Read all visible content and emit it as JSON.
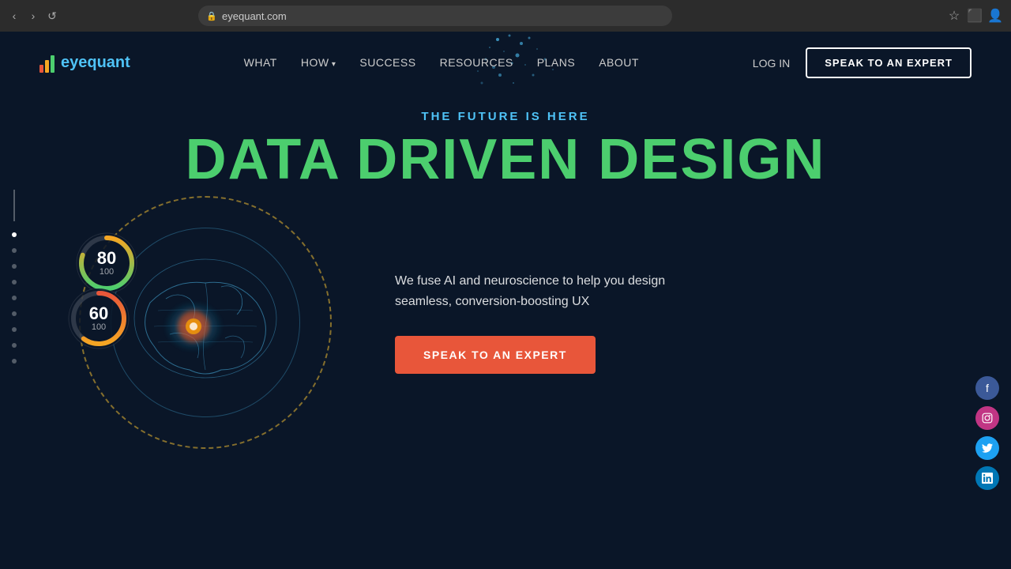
{
  "browser": {
    "url": "eyequant.com",
    "nav_back": "‹",
    "nav_forward": "›",
    "reload": "↺"
  },
  "navbar": {
    "logo_text_1": "eye",
    "logo_text_2": "quant",
    "nav_items": [
      {
        "label": "WHAT",
        "has_arrow": false
      },
      {
        "label": "HOW",
        "has_arrow": true
      },
      {
        "label": "SUCCESS",
        "has_arrow": false
      },
      {
        "label": "RESOURCES",
        "has_arrow": false
      },
      {
        "label": "PLANS",
        "has_arrow": false
      },
      {
        "label": "ABOUT",
        "has_arrow": false
      }
    ],
    "login_label": "LOG IN",
    "cta_label": "SPEAK TO AN EXPERT"
  },
  "hero": {
    "subtitle": "THE FUTURE IS HERE",
    "title": "DATA DRIVEN DESIGN",
    "description_line1": "We fuse AI and neuroscience to help you design",
    "description_line2": "seamless, conversion-boosting UX",
    "cta_label": "SPEAK TO AN EXPERT"
  },
  "gauges": [
    {
      "value": "80",
      "max": "100",
      "color_start": "#4cce6e",
      "color_end": "#f5a623",
      "pct": 80
    },
    {
      "value": "60",
      "max": "100",
      "color_start": "#f5a623",
      "color_end": "#e8563a",
      "pct": 60
    }
  ],
  "social": [
    {
      "icon": "f",
      "label": "facebook",
      "bg": "#3b5998"
    },
    {
      "icon": "in",
      "label": "instagram",
      "bg": "#c13584"
    },
    {
      "icon": "🐦",
      "label": "twitter",
      "bg": "#1da1f2"
    },
    {
      "icon": "in",
      "label": "linkedin",
      "bg": "#0077b5"
    }
  ],
  "sidebar_dots": [
    {
      "active": true
    },
    {
      "active": false
    },
    {
      "active": false
    },
    {
      "active": false
    },
    {
      "active": false
    },
    {
      "active": false
    },
    {
      "active": false
    },
    {
      "active": false
    },
    {
      "active": false
    }
  ],
  "colors": {
    "bg": "#0a1628",
    "green": "#4cce6e",
    "blue": "#4fc3f7",
    "orange": "#e8563a",
    "nav_border": "rgba(255,255,255,0.8)"
  }
}
